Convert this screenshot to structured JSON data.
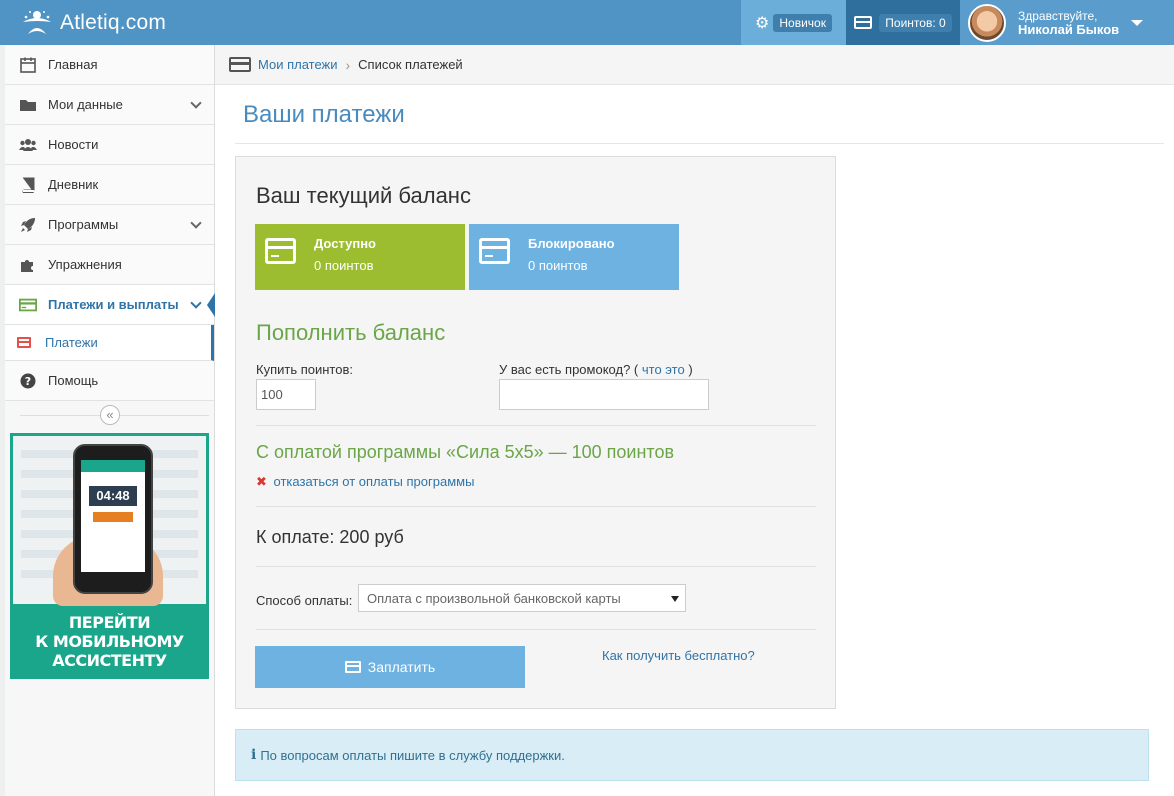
{
  "header": {
    "site_name": "Atletiq.com",
    "level_badge": "Новичок",
    "points_badge": "Поинтов: 0",
    "greeting": "Здравствуйте,",
    "user_name": "Николай Быков"
  },
  "sidebar": {
    "items": [
      {
        "label": "Главная",
        "icon": "calendar-icon"
      },
      {
        "label": "Мои данные",
        "icon": "folder-icon"
      },
      {
        "label": "Новости",
        "icon": "users-icon"
      },
      {
        "label": "Дневник",
        "icon": "book-icon"
      },
      {
        "label": "Программы",
        "icon": "rocket-icon"
      },
      {
        "label": "Упражнения",
        "icon": "puzzle-icon"
      },
      {
        "label": "Платежи и выплаты",
        "icon": "credit-card-icon"
      },
      {
        "label": "Помощь",
        "icon": "question-icon"
      }
    ],
    "subitem_label": "Платежи",
    "collapse_glyph": "«",
    "banner": {
      "line1": "ПЕРЕЙТИ",
      "line2": "К МОБИЛЬНОМУ",
      "line3": "АССИСТЕНТУ",
      "phone_time": "04:48"
    }
  },
  "breadcrumb": {
    "parent": "Мои платежи",
    "current": "Список платежей"
  },
  "page": {
    "title": "Ваши платежи"
  },
  "balance": {
    "title": "Ваш текущий баланс",
    "available_label": "Доступно",
    "available_value": "0 поинтов",
    "blocked_label": "Блокировано",
    "blocked_value": "0 поинтов"
  },
  "refill": {
    "title": "Пополнить баланс",
    "buy_label": "Купить поинтов:",
    "buy_value": "100",
    "promo_label": "У вас есть промокод? (",
    "promo_link": "что это",
    "promo_close": ")",
    "program_text": "С оплатой программы «Сила 5х5» — 100 поинтов",
    "cancel_link": "отказаться от оплаты программы",
    "total": "К оплате: 200 руб",
    "method_label": "Способ оплаты:",
    "method_value": "Оплата с произвольной банковской карты",
    "pay_button": "Заплатить",
    "free_link": "Как получить бесплатно?"
  },
  "info": {
    "text": "По вопросам оплаты пишите в службу поддержки."
  },
  "colors": {
    "header": "#4f94c4",
    "available": "#9bbd2f",
    "blocked": "#6db2e0",
    "accent_green": "#6aa648",
    "link": "#2f74a8"
  }
}
